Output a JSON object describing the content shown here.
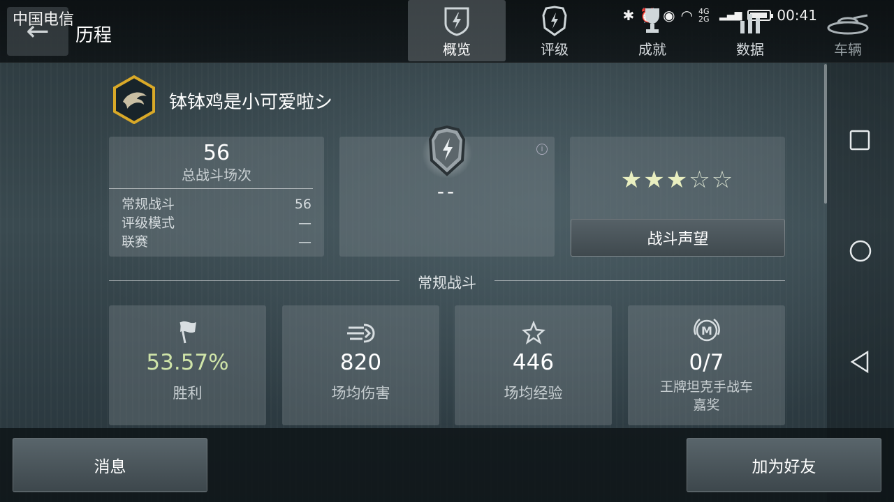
{
  "status_bar": {
    "carrier": "中国电信",
    "network": "4G 2G",
    "time": "00:41"
  },
  "header": {
    "title": "历程",
    "tabs": [
      {
        "label": "概览",
        "icon": "shield-lightning-icon",
        "active": true
      },
      {
        "label": "评级",
        "icon": "rating-shield-icon",
        "active": false
      },
      {
        "label": "成就",
        "icon": "trophy-icon",
        "active": false
      },
      {
        "label": "数据",
        "icon": "bar-chart-icon",
        "active": false
      },
      {
        "label": "车辆",
        "icon": "tank-icon",
        "active": false
      }
    ]
  },
  "player": {
    "name": "钵钵鸡是小可爱啦シ"
  },
  "battles": {
    "total": "56",
    "total_label": "总战斗场次",
    "rows": [
      {
        "label": "常规战斗",
        "value": "56"
      },
      {
        "label": "评级模式",
        "value": "—"
      },
      {
        "label": "联赛",
        "value": "—"
      }
    ]
  },
  "rating": {
    "value": "--",
    "info_icon": "i"
  },
  "prestige": {
    "stars_filled": 3,
    "stars_total": 5,
    "button_label": "战斗声望"
  },
  "section": {
    "label": "常规战斗"
  },
  "stats": [
    {
      "icon": "flag-icon",
      "value": "53.57%",
      "label": "胜利",
      "highlight": true
    },
    {
      "icon": "damage-icon",
      "value": "820",
      "label": "场均伤害",
      "highlight": false
    },
    {
      "icon": "star-outline-icon",
      "value": "446",
      "label": "场均经验",
      "highlight": false
    },
    {
      "icon": "mastery-badge-icon",
      "value": "0/7",
      "label": "王牌坦克手战车\n嘉奖",
      "highlight": false
    }
  ],
  "footer": {
    "message_label": "消息",
    "add_friend_label": "加为好友"
  },
  "colors": {
    "win_rate": "#cfe4a8",
    "accent_gold": "#d9a928"
  }
}
